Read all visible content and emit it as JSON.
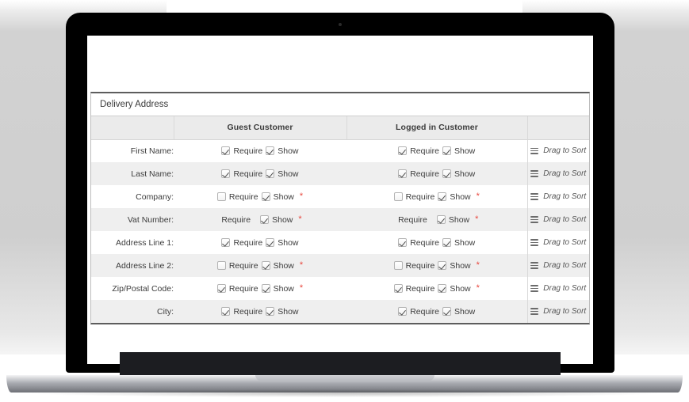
{
  "device": {
    "type": "laptop-mockup",
    "camera_icon": "camera-dot"
  },
  "panel": {
    "title": "Delivery Address"
  },
  "table": {
    "columns": [
      {
        "key": "field",
        "label": ""
      },
      {
        "key": "guest",
        "label": "Guest Customer"
      },
      {
        "key": "logged",
        "label": "Logged in Customer"
      },
      {
        "key": "sort",
        "label": ""
      }
    ],
    "labels": {
      "require": "Require",
      "show": "Show",
      "required_marker": "*",
      "drag_to_sort": "Drag to Sort",
      "drag_handle_icon": "hamburger-drag-icon"
    },
    "rows": [
      {
        "field": "First Name:",
        "guest": {
          "require_visible": true,
          "require_checked": true,
          "show_checked": true,
          "required_marker": false
        },
        "logged": {
          "require_visible": true,
          "require_checked": true,
          "show_checked": true,
          "required_marker": false
        },
        "sort": "Drag to Sort"
      },
      {
        "field": "Last Name:",
        "guest": {
          "require_visible": true,
          "require_checked": true,
          "show_checked": true,
          "required_marker": false
        },
        "logged": {
          "require_visible": true,
          "require_checked": true,
          "show_checked": true,
          "required_marker": false
        },
        "sort": "Drag to Sort"
      },
      {
        "field": "Company:",
        "guest": {
          "require_visible": true,
          "require_checked": false,
          "show_checked": true,
          "required_marker": true
        },
        "logged": {
          "require_visible": true,
          "require_checked": false,
          "show_checked": true,
          "required_marker": true
        },
        "sort": "Drag to Sort"
      },
      {
        "field": "Vat Number:",
        "guest": {
          "require_visible": false,
          "require_checked": false,
          "show_checked": true,
          "required_marker": true
        },
        "logged": {
          "require_visible": false,
          "require_checked": false,
          "show_checked": true,
          "required_marker": true
        },
        "sort": "Drag to Sort"
      },
      {
        "field": "Address Line 1:",
        "guest": {
          "require_visible": true,
          "require_checked": true,
          "show_checked": true,
          "required_marker": false
        },
        "logged": {
          "require_visible": true,
          "require_checked": true,
          "show_checked": true,
          "required_marker": false
        },
        "sort": "Drag to Sort"
      },
      {
        "field": "Address Line 2:",
        "guest": {
          "require_visible": true,
          "require_checked": false,
          "show_checked": true,
          "required_marker": true
        },
        "logged": {
          "require_visible": true,
          "require_checked": false,
          "show_checked": true,
          "required_marker": true
        },
        "sort": "Drag to Sort"
      },
      {
        "field": "Zip/Postal Code:",
        "guest": {
          "require_visible": true,
          "require_checked": true,
          "show_checked": true,
          "required_marker": true
        },
        "logged": {
          "require_visible": true,
          "require_checked": true,
          "show_checked": true,
          "required_marker": true
        },
        "sort": "Drag to Sort"
      },
      {
        "field": "City:",
        "guest": {
          "require_visible": true,
          "require_checked": true,
          "show_checked": true,
          "required_marker": false
        },
        "logged": {
          "require_visible": true,
          "require_checked": true,
          "show_checked": true,
          "required_marker": false
        },
        "sort": "Drag to Sort"
      }
    ]
  },
  "colors": {
    "required_marker": "#e8453c",
    "header_background": "#ebebeb",
    "row_stripe": "#efefef",
    "text": "#3c3c3c"
  }
}
